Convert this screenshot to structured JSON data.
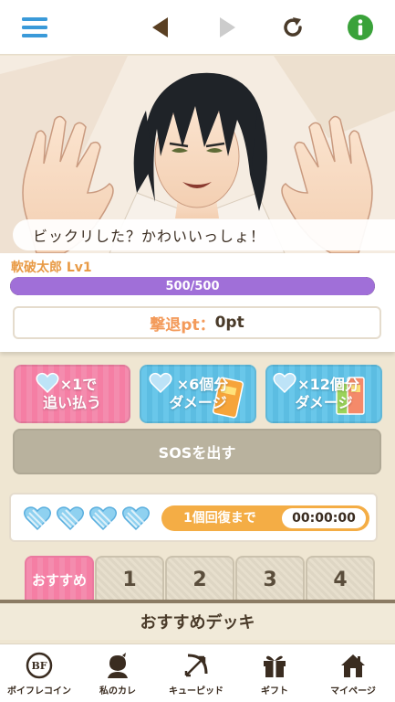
{
  "topbar": {
    "menu_icon": "hamburger-menu-icon",
    "back_icon": "triangle-left-icon",
    "forward_icon": "triangle-right-icon",
    "reload_icon": "reload-icon",
    "info_icon": "info-icon"
  },
  "scene": {
    "speech": "ビックリした？かわいいっしょ！"
  },
  "status": {
    "character_name": "軟破太郎 Lv1",
    "hp_text": "500/500",
    "hp_fraction": 1.0,
    "score_label": "撃退pt：",
    "score_value": "0pt"
  },
  "actions": {
    "chase_line1": "×1で",
    "chase_line2": "追い払う",
    "damage6_line1": "×6個分",
    "damage6_line2": "ダメージ",
    "damage12_line1": "×12個分",
    "damage12_line2": "ダメージ",
    "sos_label": "SOSを出す"
  },
  "hearts": {
    "count": 4,
    "recover_label": "1個回復まで",
    "recover_time": "00:00:00"
  },
  "tabs": [
    {
      "label": "おすすめ"
    },
    {
      "label": "1"
    },
    {
      "label": "2"
    },
    {
      "label": "3"
    },
    {
      "label": "4"
    }
  ],
  "deck_header": "おすすめデッキ",
  "bottom_nav": [
    {
      "label": "ボイフレコイン",
      "icon": "bf-coin-icon"
    },
    {
      "label": "私のカレ",
      "icon": "boyfriend-icon"
    },
    {
      "label": "キューピッド",
      "icon": "cupid-bow-icon"
    },
    {
      "label": "ギフト",
      "icon": "gift-icon"
    },
    {
      "label": "マイページ",
      "icon": "home-icon"
    }
  ],
  "colors": {
    "accent_pink": "#f48cae",
    "accent_blue": "#69c7ea",
    "hp_purple": "#a06fd8",
    "recover_orange": "#f4ad45",
    "info_green": "#3aa23a",
    "menu_blue": "#3a9ad9"
  }
}
